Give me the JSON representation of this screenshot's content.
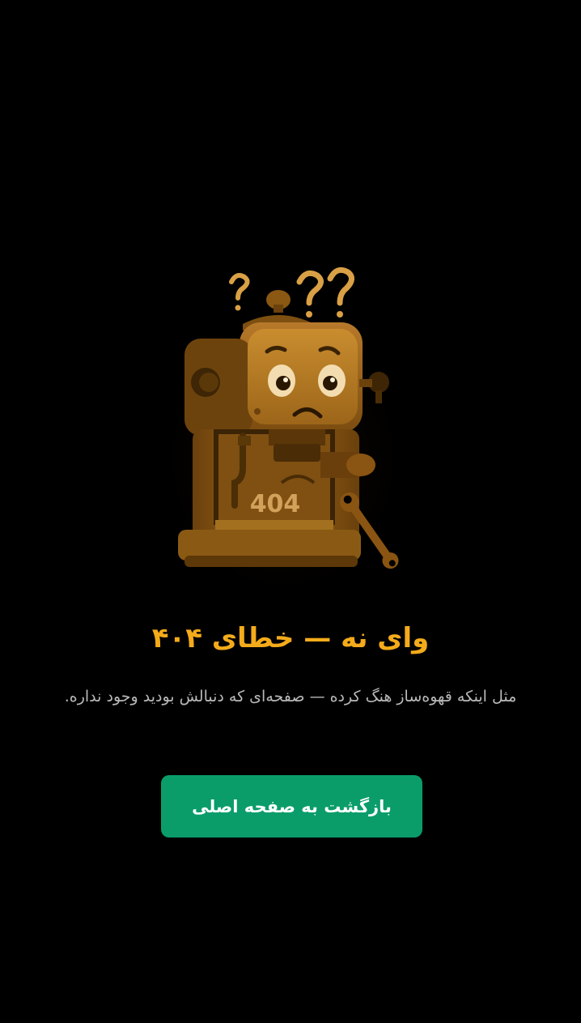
{
  "illustration": {
    "icon": "sad-coffee-machine-illustration",
    "machine_label": "404",
    "colors": {
      "body": "#9a6414",
      "body_dark": "#5b3608",
      "body_light": "#c88c2a",
      "accent": "#d9a045"
    }
  },
  "error": {
    "title": "وای نه — خطای ۴۰۴",
    "message": "مثل اینکه قهوه‌ساز هنگ کرده — صفحه‌ای که دنبالش بودید وجود نداره.",
    "home_button_label": "بازگشت به صفحه اصلی"
  },
  "colors": {
    "background": "#000000",
    "title": "#f4ab1a",
    "message": "#b9b9b9",
    "button": "#0a9d6a",
    "button_text": "#ffffff"
  }
}
